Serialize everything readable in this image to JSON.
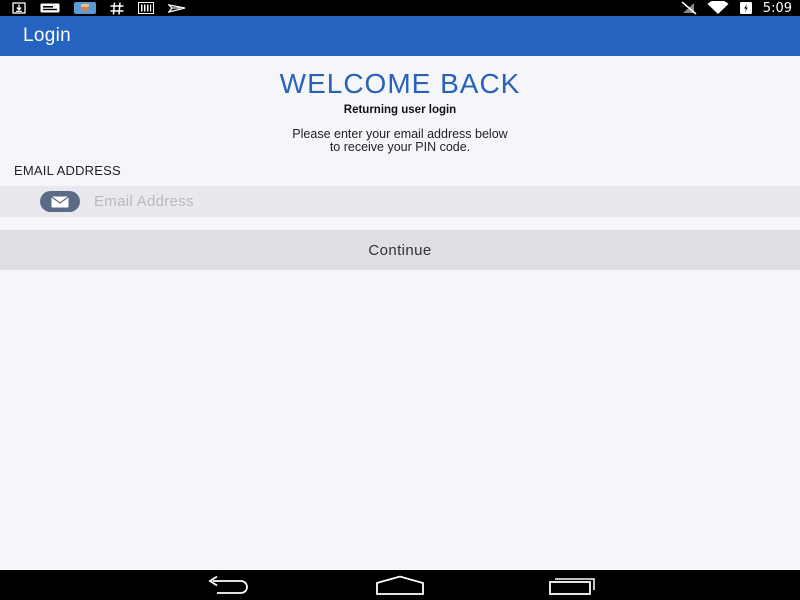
{
  "status_bar": {
    "time": "5:09",
    "left_icons": [
      "download-icon",
      "message-icon",
      "photo-icon",
      "hash-icon",
      "barcode-icon",
      "airplane-notification-icon"
    ],
    "right_icons": [
      "signal-muted-icon",
      "wifi-icon",
      "battery-icon"
    ]
  },
  "app_bar": {
    "title": "Login",
    "color": "#2463bf"
  },
  "main": {
    "heading": "WELCOME BACK",
    "subheading": "Returning user login",
    "instruction_line1": "Please enter your email address below",
    "instruction_line2": "to receive your PIN code.",
    "email_label": "EMAIL ADDRESS",
    "email_placeholder": "Email Address",
    "email_value": "",
    "continue_label": "Continue"
  },
  "nav_bar": {
    "buttons": [
      "back-icon",
      "home-icon",
      "recents-icon"
    ]
  },
  "colors": {
    "accent": "#2463bf",
    "heading": "#2a62b8",
    "background": "#f5f6fa"
  }
}
